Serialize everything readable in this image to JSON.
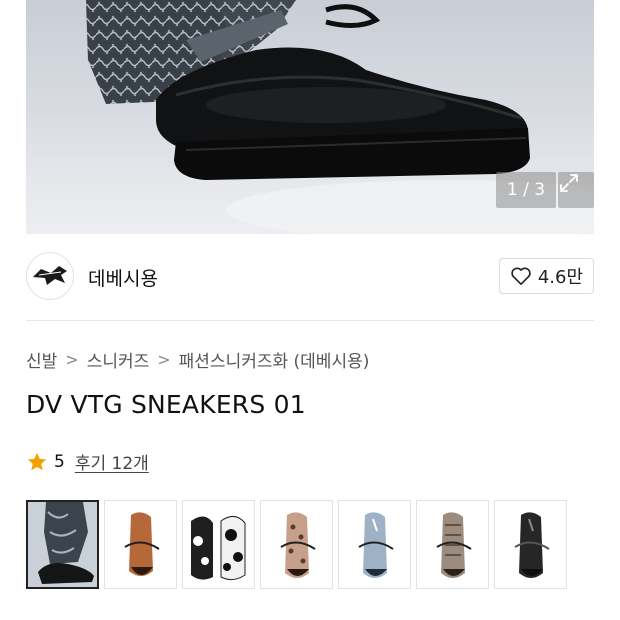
{
  "gallery": {
    "counter": "1 / 3",
    "expand_icon": "expand-icon"
  },
  "shop": {
    "name": "데베시용",
    "like_count": "4.6만",
    "logo_icon": "bird-logo-icon"
  },
  "breadcrumb": [
    "신발",
    "스니커즈",
    "패션스니커즈화 (데베시용)"
  ],
  "product": {
    "title": "DV VTG SNEAKERS 01",
    "rating": "5",
    "review_label": "후기 12개"
  },
  "thumbnails": [
    {
      "name": "thumb-black-high",
      "color": "#2a2c30",
      "active": true
    },
    {
      "name": "thumb-brown",
      "color": "#b5683a",
      "active": false
    },
    {
      "name": "thumb-cow-print",
      "color": "#1f1f1f",
      "active": false
    },
    {
      "name": "thumb-leopard",
      "color": "#c7a08c",
      "active": false
    },
    {
      "name": "thumb-light-blue",
      "color": "#9fb1c4",
      "active": false
    },
    {
      "name": "thumb-snake",
      "color": "#9c8c80",
      "active": false
    },
    {
      "name": "thumb-black-low",
      "color": "#262626",
      "active": false
    }
  ],
  "colors": {
    "star": "#f4a100",
    "text_primary": "#111111",
    "border": "#e3e3e3"
  }
}
